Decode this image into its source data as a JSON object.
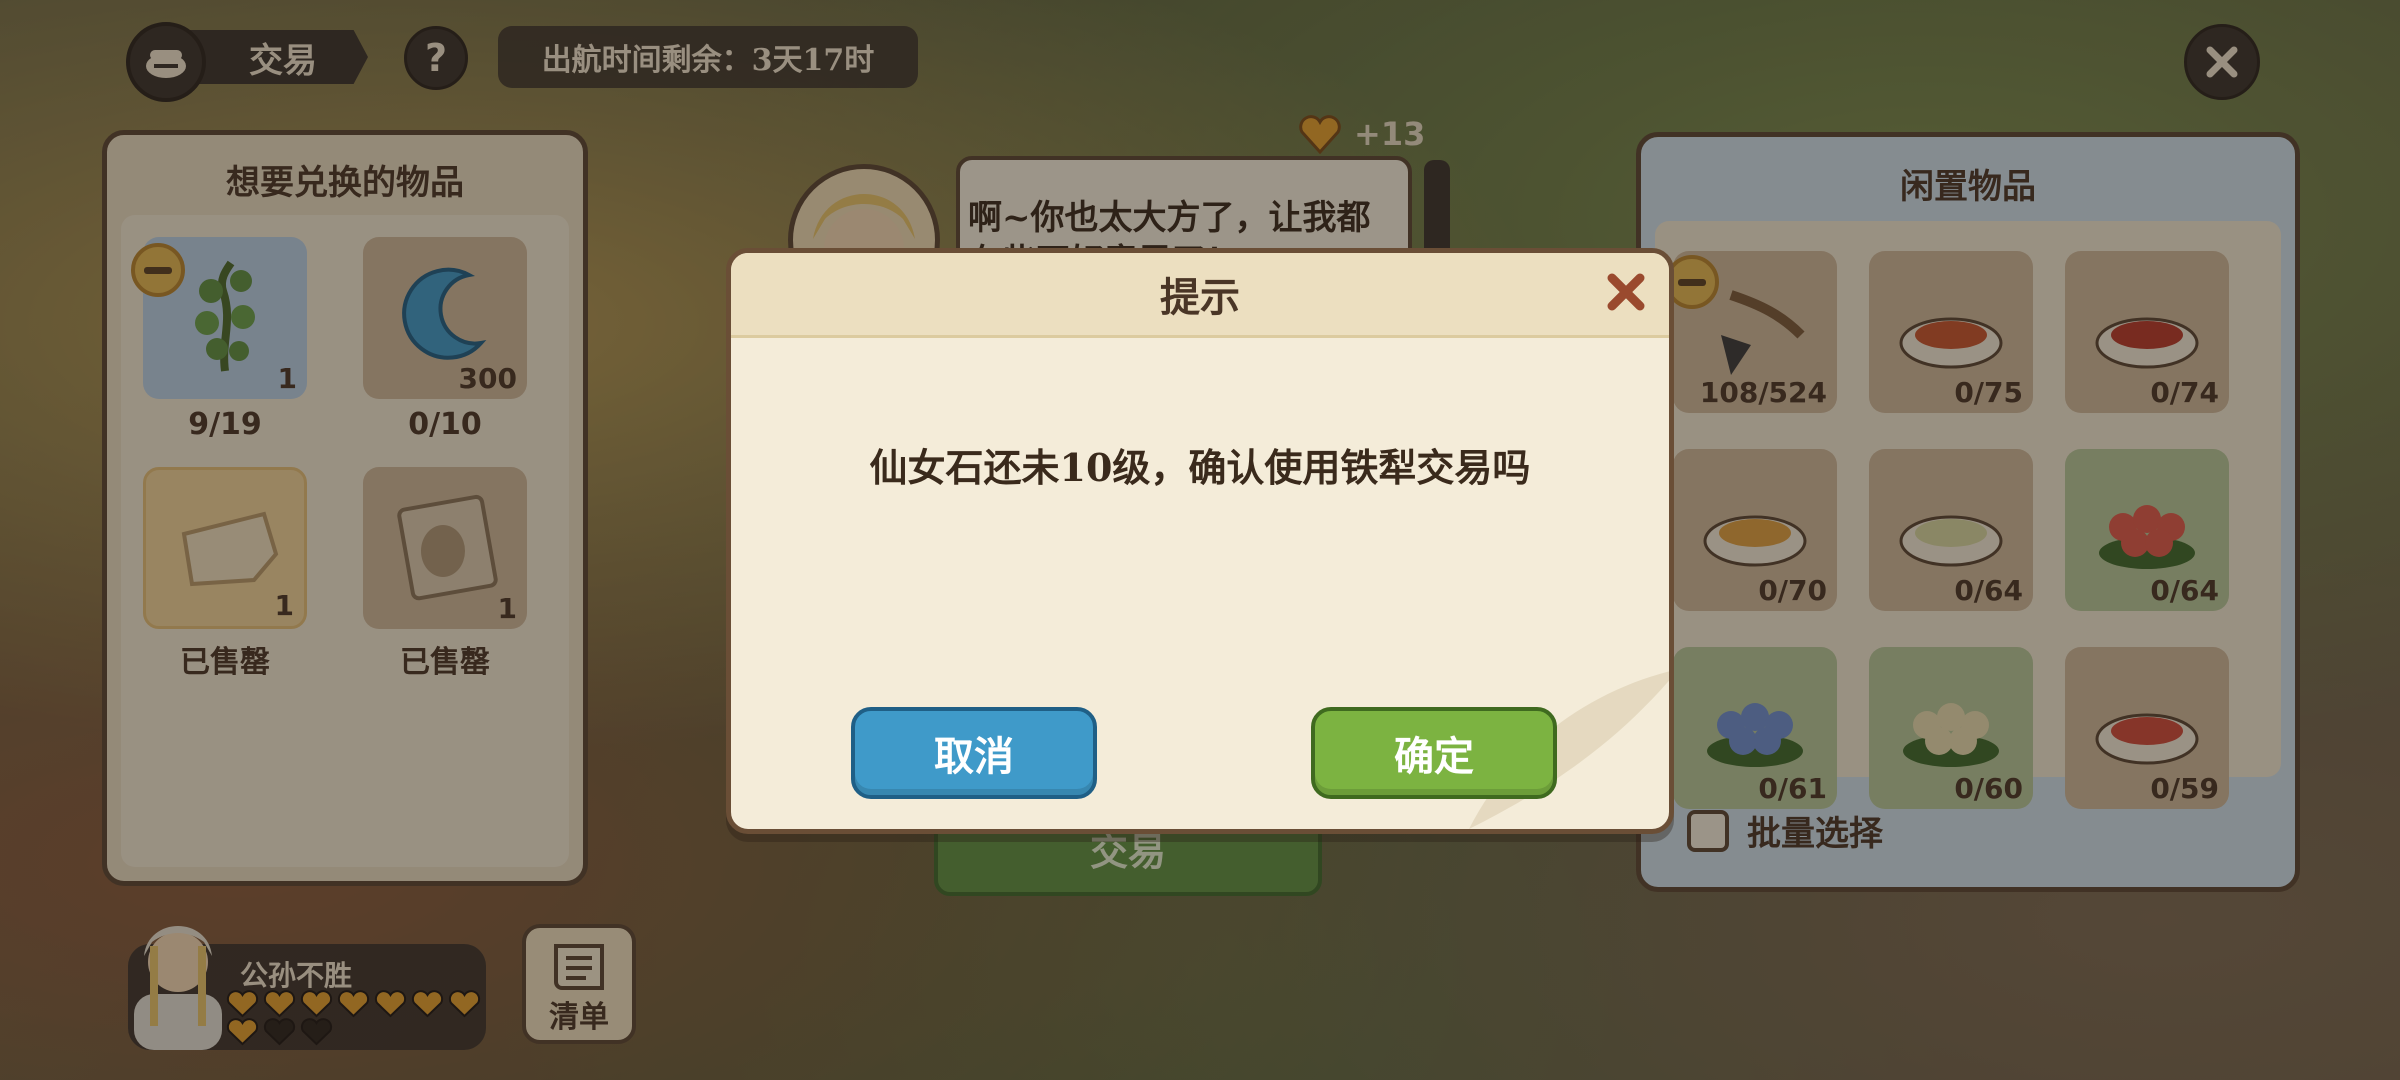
{
  "header": {
    "title": "交易",
    "help_label": "?",
    "sail_timer": "出航时间剩余：3天17时"
  },
  "left_panel": {
    "title": "想要兑换的物品",
    "items": [
      {
        "icon": "vine-plant-icon",
        "count": "1",
        "label": "9/19"
      },
      {
        "icon": "crescent-moon-icon",
        "count": "300",
        "label": "0/10"
      },
      {
        "icon": "cloth-icon",
        "count": "1",
        "label": "已售罄"
      },
      {
        "icon": "fruit-wine-label-icon",
        "count": "1",
        "label": "已售罄"
      }
    ]
  },
  "npc": {
    "speech": "啊~你也太大方了，让我都有些不好意思了！",
    "affinity": "+13"
  },
  "trade_button": "交易",
  "right_panel": {
    "title": "闲置物品",
    "items": [
      {
        "icon": "iron-plow-icon",
        "label": "108/524"
      },
      {
        "icon": "food-dish-icon",
        "label": "0/75"
      },
      {
        "icon": "food-dish-icon",
        "label": "0/74"
      },
      {
        "icon": "food-dish-icon",
        "label": "0/70"
      },
      {
        "icon": "food-dish-icon",
        "label": "0/64"
      },
      {
        "icon": "red-flower-icon",
        "label": "0/64"
      },
      {
        "icon": "blue-flower-icon",
        "label": "0/61"
      },
      {
        "icon": "white-flower-icon",
        "label": "0/60"
      },
      {
        "icon": "food-dish-icon",
        "label": "0/59"
      }
    ],
    "batch_select": "批量选择"
  },
  "player": {
    "name": "公孙不胜",
    "hearts_filled": 8,
    "hearts_total": 10
  },
  "list_button": "清单",
  "modal": {
    "title": "提示",
    "message": "仙女石还未10级，确认使用铁犁交易吗",
    "cancel": "取消",
    "confirm": "确定"
  },
  "colors": {
    "cancel_button": "#3f9ac9",
    "confirm_button": "#7cb341",
    "heart": "#e6a12e"
  }
}
